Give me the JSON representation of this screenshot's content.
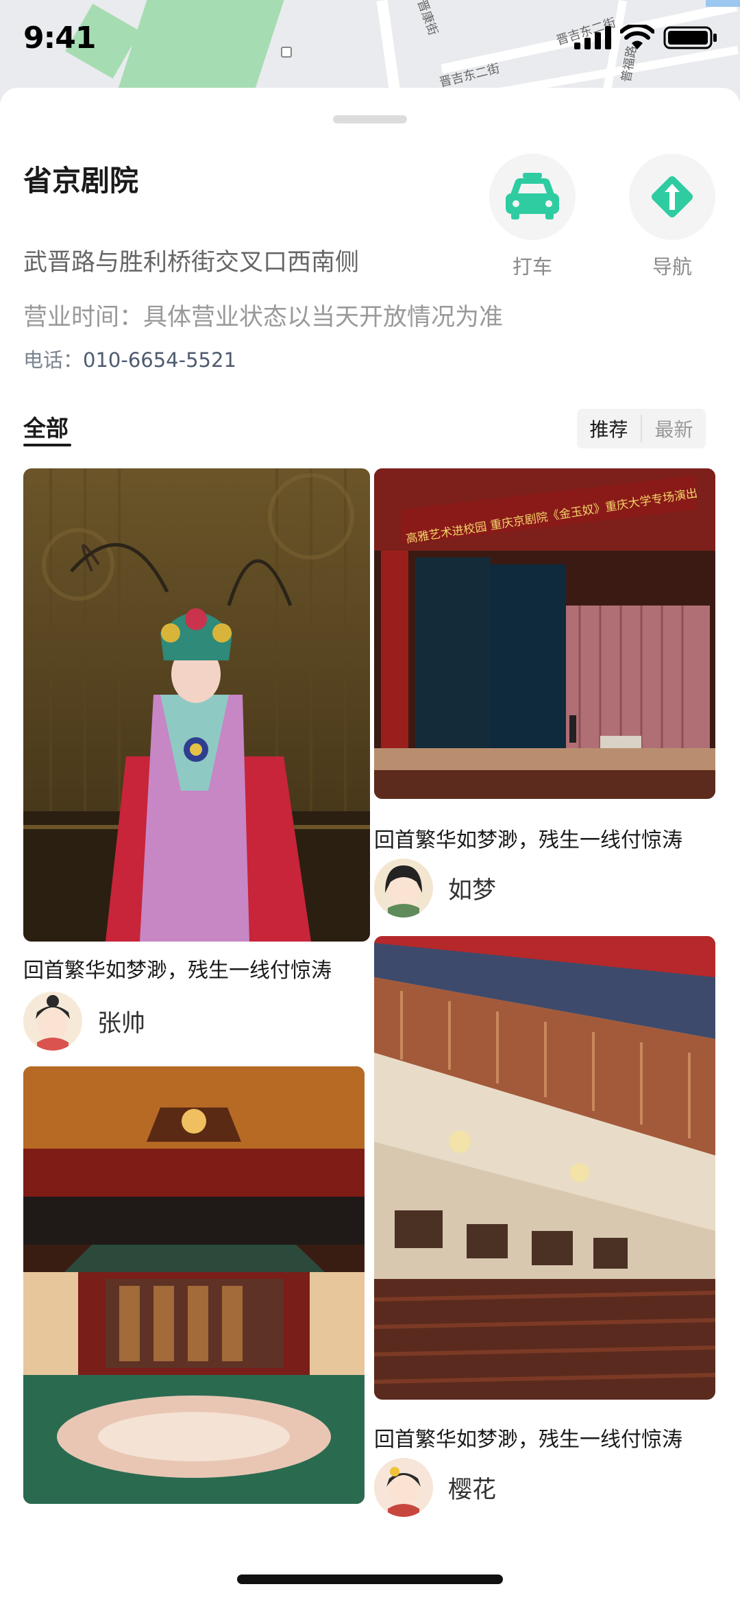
{
  "status_bar": {
    "time": "9:41"
  },
  "map": {
    "labels": [
      "晋康街",
      "晋吉东二街",
      "晋吉东二街",
      "普福路"
    ]
  },
  "place": {
    "name": "省京剧院",
    "address": "武晋路与胜利桥街交叉口西南侧",
    "hours_label": "营业时间：",
    "hours_value": "具体营业状态以当天开放情况为准",
    "phone_label": "电话：",
    "phone_value": "010-6654-5521"
  },
  "actions": [
    {
      "label": "打车",
      "icon": "taxi-icon",
      "color": "#2fcca1"
    },
    {
      "label": "导航",
      "icon": "navigation-icon",
      "color": "#2fcca1"
    }
  ],
  "tabs": {
    "active": "全部"
  },
  "sort": {
    "options": [
      "推荐",
      "最新"
    ],
    "selected": "推荐"
  },
  "cards": [
    {
      "title": "回首繁华如梦渺，残生一线付惊涛",
      "author": "张帅",
      "image": "peking-opera-performer-photo"
    },
    {
      "title": "回首繁华如梦渺，残生一线付惊涛",
      "author": "如梦",
      "image": "theater-stage-photo"
    },
    {
      "title": "",
      "author": "",
      "image": "theater-interior-stage-photo"
    },
    {
      "title": "回首繁华如梦渺，残生一线付惊涛",
      "author": "樱花",
      "image": "theater-balcony-seats-photo"
    }
  ],
  "stage_banner": "高雅艺术进校园  重庆京剧院《金玉奴》重庆大学专场演出"
}
